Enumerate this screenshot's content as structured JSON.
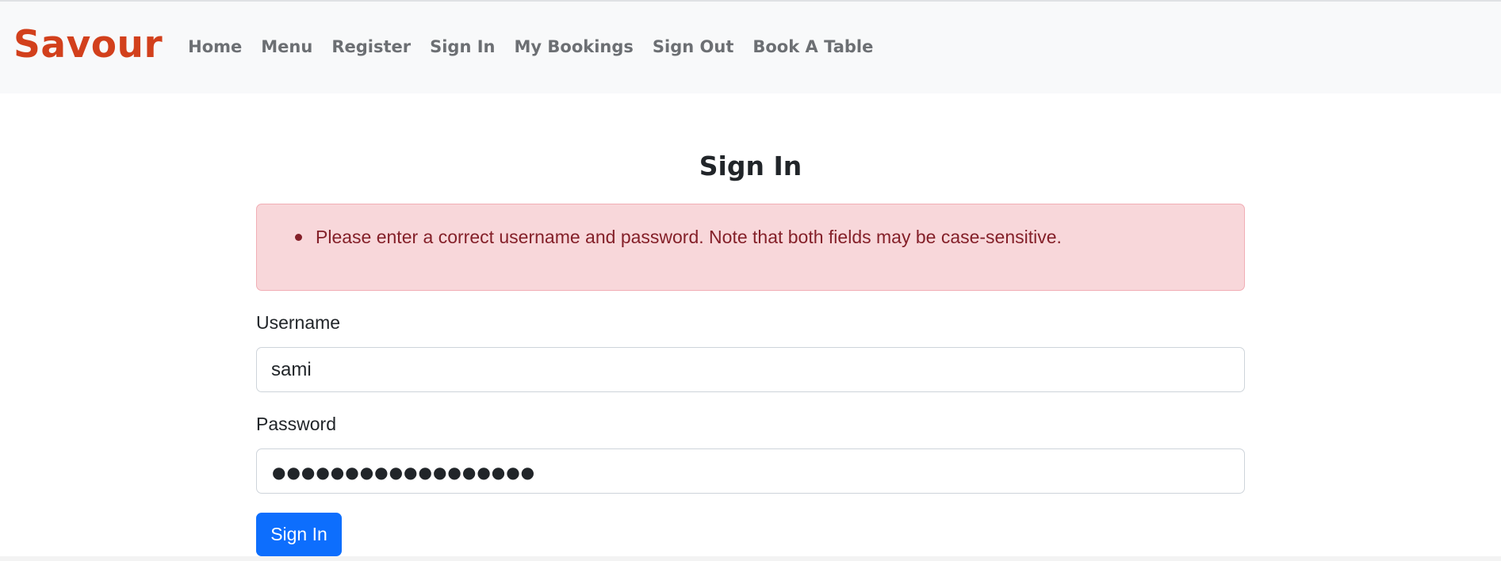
{
  "navbar": {
    "brand": "Savour",
    "links": [
      "Home",
      "Menu",
      "Register",
      "Sign In",
      "My Bookings",
      "Sign Out",
      "Book A Table"
    ]
  },
  "page": {
    "title": "Sign In"
  },
  "alert": {
    "errors": [
      "Please enter a correct username and password. Note that both fields may be case-sensitive."
    ]
  },
  "form": {
    "username_label": "Username",
    "username_value": "sami",
    "password_label": "Password",
    "password_display": "●●●●●●●●●●●●●●●●●●",
    "submit_label": "Sign In"
  },
  "colors": {
    "brand": "#d2401c",
    "primary": "#0d6efd",
    "alert_bg": "#f8d7da",
    "alert_text": "#842029",
    "navbar_bg": "#f8f9fa"
  }
}
